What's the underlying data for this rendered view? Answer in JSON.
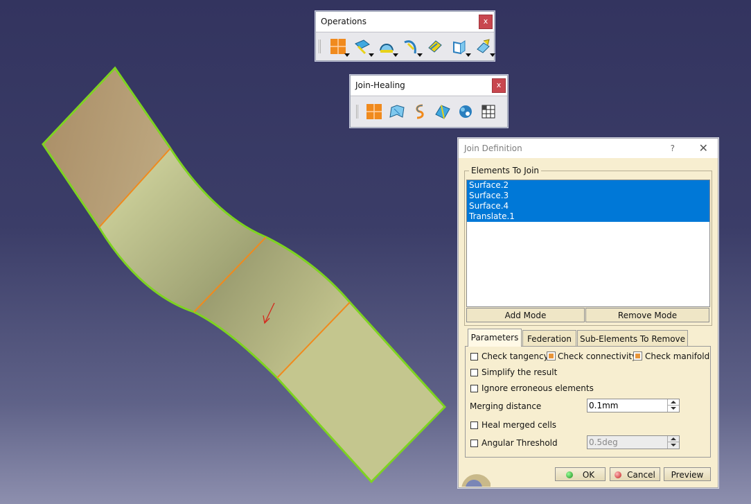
{
  "viewport": {
    "surface_colors": {
      "fill": "#c7cc92",
      "shade": "#a89870",
      "edge": "#7ed321",
      "seam": "#f08a1d",
      "arrow": "#d4281c"
    }
  },
  "operations_toolbar": {
    "title": "Operations",
    "close_label": "x",
    "tools": [
      "join-icon",
      "healing-icon",
      "extrapolate-icon",
      "split-icon",
      "trim-icon",
      "boundary-icon",
      "extract-icon"
    ]
  },
  "join_healing_toolbar": {
    "title": "Join-Healing",
    "close_label": "x",
    "tools": [
      "join-icon",
      "healing-icon",
      "curve-smooth-icon",
      "surface-simplification-icon",
      "untrim-icon",
      "disassemble-icon"
    ]
  },
  "dialog": {
    "title": "Join Definition",
    "help_label": "?",
    "close_label": "✕",
    "elements_group_label": "Elements To Join",
    "elements": [
      "Surface.2",
      "Surface.3",
      "Surface.4",
      "Translate.1"
    ],
    "add_mode_label": "Add Mode",
    "remove_mode_label": "Remove Mode",
    "tabs": [
      "Parameters",
      "Federation",
      "Sub-Elements To Remove"
    ],
    "options": {
      "check_tangency": "Check tangency",
      "check_connectivity": "Check connectivity",
      "check_manifold": "Check manifold",
      "simplify": "Simplify the result",
      "ignore_erroneous": "Ignore erroneous elements",
      "merging_distance_label": "Merging distance",
      "merging_distance_value": "0.1mm",
      "heal_merged": "Heal merged cells",
      "angular_threshold_label": "Angular Threshold",
      "angular_threshold_value": "0.5deg"
    },
    "ok_label": "OK",
    "cancel_label": "Cancel",
    "preview_label": "Preview"
  }
}
